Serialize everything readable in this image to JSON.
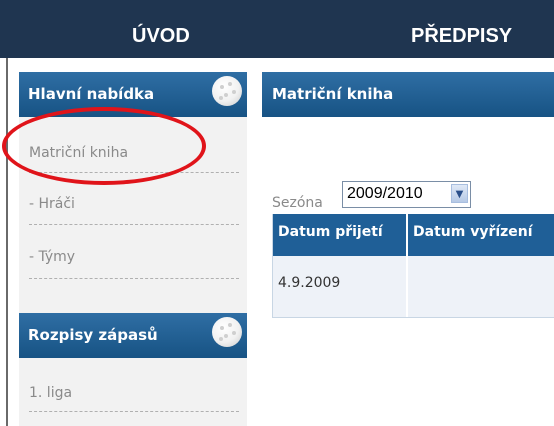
{
  "nav": {
    "tabs": [
      {
        "label": "ÚVOD"
      },
      {
        "label": "PŘEDPISY"
      }
    ]
  },
  "main_menu": {
    "title": "Hlavní nabídka",
    "items": [
      {
        "label": "Matriční kniha"
      },
      {
        "label": "- Hráči"
      },
      {
        "label": "- Týmy"
      }
    ]
  },
  "schedule_menu": {
    "title": "Rozpisy zápasů",
    "items": [
      {
        "label": "1. liga"
      }
    ]
  },
  "content": {
    "title": "Matriční kniha",
    "season_label": "Sezóna",
    "season_value": "2009/2010",
    "table": {
      "headers": [
        "Datum přijetí",
        "Datum vyřízení"
      ],
      "rows": [
        [
          "4.9.2009",
          ""
        ]
      ]
    }
  },
  "annotation": {
    "color": "#e0141a"
  }
}
